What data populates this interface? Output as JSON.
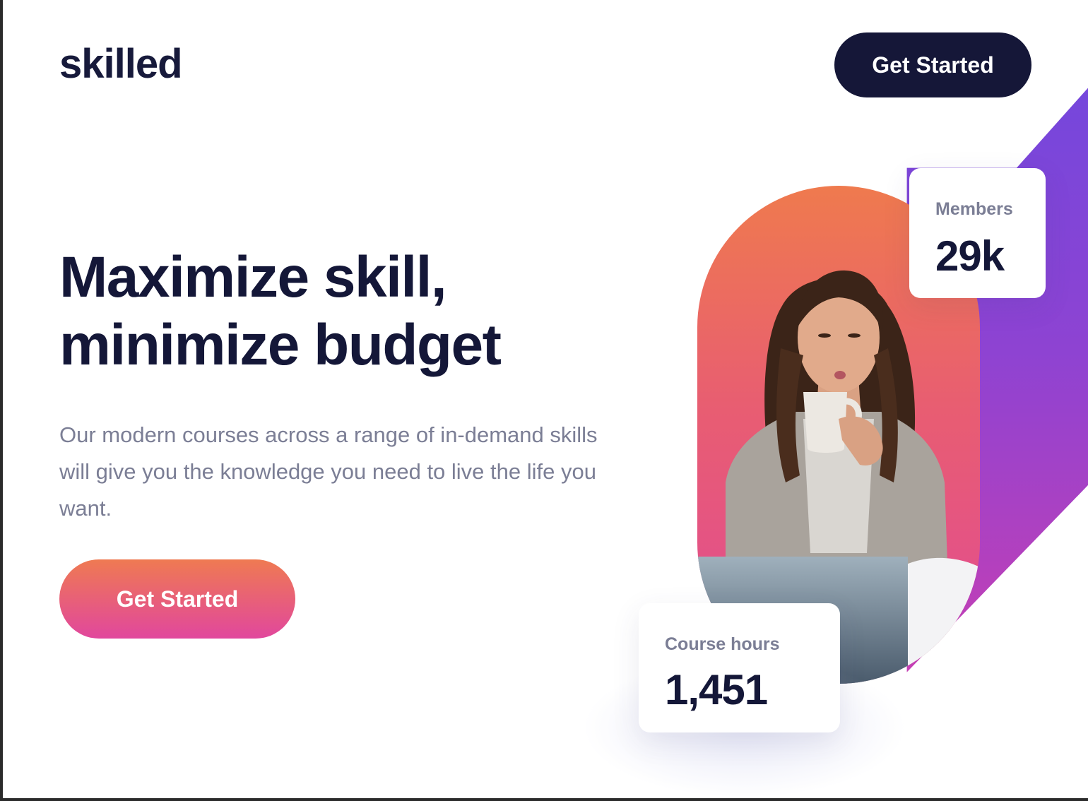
{
  "header": {
    "logo": "skilled",
    "cta_label": "Get Started"
  },
  "hero": {
    "headline_line1": "Maximize skill,",
    "headline_line2": "minimize budget",
    "subtext": "Our modern courses across a range of in-demand skills will give you the knowledge you need to live the life you want.",
    "cta_label": "Get Started"
  },
  "stats": {
    "members": {
      "label": "Members",
      "value": "29k"
    },
    "course_hours": {
      "label": "Course hours",
      "value": "1,451"
    }
  },
  "colors": {
    "navy": "#141738",
    "body_text": "#7b7e95",
    "gradient_orange": "#ef7a52",
    "gradient_pink": "#e1479d",
    "accent_purple": "#7547dc"
  }
}
